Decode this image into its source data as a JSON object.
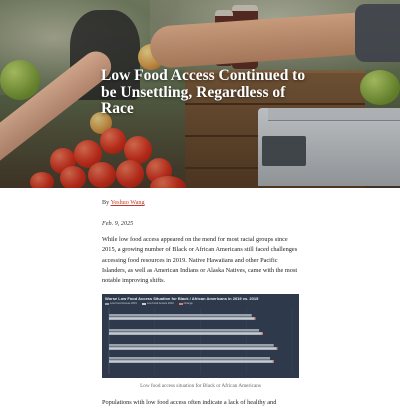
{
  "hero": {
    "title": "Low Food Access Continued to be Unsettling, Regardless of Race"
  },
  "article": {
    "byline_prefix": "By",
    "author": "Yeshuo Wang",
    "date": "Feb. 9, 2025",
    "paragraph1": "While low food access appeared on the mend for most racial groups since 2015, a growing number of Black or African Americans still faced challenges accessing food resources in 2019. Native Hawaiians and other Pacific Islanders, as well as American Indians or Alaska Natives, came with the most notable improving shifts.",
    "figure_caption": "Low food access situation for Black or African Americans",
    "paragraph2": "Populations with low food access often indicate a lack of healthy and"
  },
  "chart_data": {
    "type": "bar",
    "orientation": "horizontal",
    "title": "Worse Low Food Access Situation for Black / African Americans in 2019 vs. 2015",
    "legend": [
      "Low Food Access 2015",
      "Low Food Access 2019",
      "Change"
    ],
    "colors": {
      "s2015": "#9aa3ad",
      "s2019": "#c7ccd2",
      "accent": "#e07b6a",
      "background": "#2e3a4b"
    },
    "categories": [
      "",
      "",
      "",
      ""
    ],
    "series": [
      {
        "name": "Low Food Access 2015",
        "values": [
          78,
          82,
          90,
          88
        ]
      },
      {
        "name": "Low Food Access 2019",
        "values": [
          80,
          84,
          92,
          90
        ]
      }
    ],
    "xlim": [
      0,
      100
    ]
  }
}
